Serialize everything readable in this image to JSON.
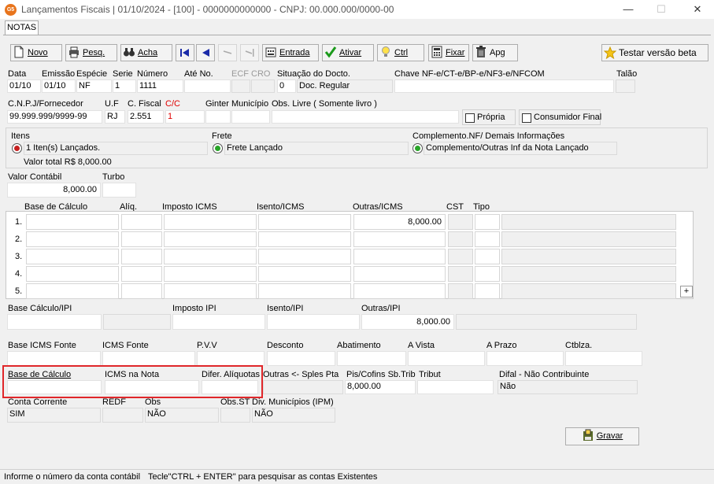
{
  "window": {
    "title": "Lançamentos Fiscais |  01/10/2024 - [100] - 0000000000000 - CNPJ: 00.000.000/0000-00",
    "app_icon_text": "G5"
  },
  "tabs": [
    {
      "label": "NOTAS"
    }
  ],
  "toolbar": {
    "novo": "Novo",
    "pesq": "Pesq.",
    "acha": "Acha",
    "entrada": "Entrada",
    "ativar": "Ativar",
    "ctrl": "Ctrl",
    "fixar": "Fixar",
    "apg": "Apg",
    "testar": "Testar versão beta"
  },
  "header": {
    "data_label": "Data",
    "data": "01/10",
    "emissao_label": "Emissão",
    "emissao": "01/10",
    "especie_label": "Espécie",
    "especie": "NF",
    "serie_label": "Serie",
    "serie": "1",
    "numero_label": "Número",
    "numero": "1111",
    "ate_label": "Até No.",
    "ate": "",
    "ecf_label": "ECF",
    "cro_label": "CRO",
    "situacao_label": "Situação do Docto.",
    "situacao_code": "0",
    "situacao_desc": "Doc. Regular",
    "chave_label": "Chave NF-e/CT-e/BP-e/NF3-e/NFCOM",
    "chave": "",
    "talao_label": "Talão"
  },
  "row2": {
    "cnpj_label": "C.N.P.J/Fornecedor",
    "cnpj": "99.999.999/9999-99",
    "uf_label": "U.F",
    "uf": "RJ",
    "cfiscal_label": "C. Fiscal",
    "cfiscal": "2.551",
    "cc_label": "C/C",
    "cc": "1",
    "ginter_label": "Ginter",
    "municipio_label": "Município",
    "obs_label": "Obs. Livre ( Somente livro )",
    "obs": "",
    "propria_label": "Própria",
    "consumidor_label": "Consumidor Final"
  },
  "row3": {
    "itens_label": "Itens",
    "itens_value": "1 Iten(s) Lançados.",
    "valor_total": "Valor total R$ 8,000.00",
    "frete_label": "Frete",
    "frete_value": "Frete Lançado",
    "compl_label": "Complemento.NF/ Demais Informações",
    "compl_value": "Complemento/Outras Inf da Nota Lançado"
  },
  "valor": {
    "valor_label": "Valor Contábil",
    "valor": "8,000.00",
    "turbo_label": "Turbo"
  },
  "grid": {
    "headers": [
      "Base de Cálculo",
      "Alíq.",
      "Imposto ICMS",
      "Isento/ICMS",
      "Outras/ICMS",
      "CST",
      "Tipo"
    ],
    "rows": [
      {
        "num": "1.",
        "outras": "8,000.00"
      },
      {
        "num": "2.",
        "outras": ""
      },
      {
        "num": "3.",
        "outras": ""
      },
      {
        "num": "4.",
        "outras": ""
      },
      {
        "num": "5.",
        "outras": ""
      }
    ],
    "plus": "+"
  },
  "ipi": {
    "base_label": "Base Cálculo/IPI",
    "imposto_label": "Imposto IPI",
    "isento_label": "Isento/IPI",
    "outras_label": "Outras/IPI",
    "outras": "8,000.00"
  },
  "fonte": {
    "base_label": "Base ICMS Fonte",
    "icms_label": "ICMS Fonte",
    "pvv_label": "P.V.V",
    "desconto_label": "Desconto",
    "abatimento_label": "Abatimento",
    "avista_label": "A Vista",
    "aprazo_label": "A Prazo",
    "ctblza_label": "Ctblza."
  },
  "difal": {
    "base_label": "Base de Cálculo",
    "icms_label": "ICMS na Nota",
    "difer_label": "Difer. Alíquotas",
    "outras_label": "Outras <- Sples Pta",
    "pis_label": "Pis/Cofins Sb.Trib",
    "pis": "8,000.00",
    "tribut_label": "Tribut",
    "nao_contrib_label": "Difal - Não Contribuinte",
    "nao_contrib": "Não"
  },
  "conta": {
    "conta_label": "Conta Corrente",
    "conta": "SIM",
    "redf_label": "REDF",
    "obs_label": "Obs",
    "obs": "NÃO",
    "obsst_label": "Obs.ST",
    "div_label": "Div. Municípios (IPM)",
    "div": "NÃO"
  },
  "gravar": "Gravar",
  "status": {
    "left": "Informe o número da conta contábil",
    "right": "Tecle\"CTRL + ENTER\"  para pesquisar as contas Existentes"
  }
}
